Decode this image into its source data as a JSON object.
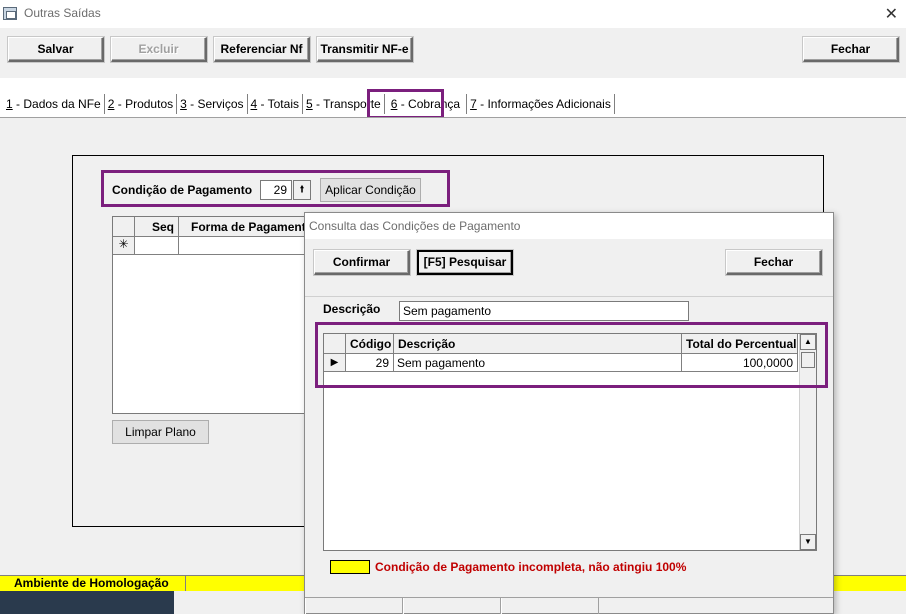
{
  "window": {
    "title": "Outras Saídas",
    "close_glyph": "✕"
  },
  "toolbar": {
    "salvar": "Salvar",
    "excluir": "Excluir",
    "referenciar": "Referenciar Nf",
    "transmitir": "Transmitir NF-e",
    "fechar": "Fechar"
  },
  "tabs": [
    {
      "key": "1",
      "label": " - Dados da NFe"
    },
    {
      "key": "2",
      "label": " - Produtos"
    },
    {
      "key": "3",
      "label": " - Serviços"
    },
    {
      "key": "4",
      "label": " - Totais"
    },
    {
      "key": "5",
      "label": " - Transporte"
    },
    {
      "key": "6",
      "label": " - Cobrança"
    },
    {
      "key": "7",
      "label": " - Informações Adicionais"
    }
  ],
  "cobranca": {
    "condicao_label": "Condição de Pagamento",
    "condicao_value": "29",
    "aplicar_button": "Aplicar Condição",
    "grid_headers": {
      "seq": "Seq",
      "forma": "Forma de Pagamento"
    },
    "new_row_marker": "✳",
    "limpar_button": "Limpar Plano"
  },
  "status": {
    "ambiente": "Ambiente de Homologação"
  },
  "dialog": {
    "title": "Consulta das Condições de Pagamento",
    "confirmar": "Confirmar",
    "pesquisar": "[F5] Pesquisar",
    "fechar": "Fechar",
    "descricao_label": "Descrição",
    "descricao_value": "Sem pagamento",
    "grid_headers": {
      "codigo": "Código",
      "descricao": "Descrição",
      "total": "Total do Percentual"
    },
    "rows": [
      {
        "codigo": "29",
        "descricao": "Sem pagamento",
        "total": "100,0000"
      }
    ],
    "row_indicator": "▶",
    "legend_text": "Condição de Pagamento incompleta, não atingiu 100%"
  },
  "colors": {
    "highlight": "#7b1f7d",
    "status_yellow": "#ffff00",
    "warning_red": "#c00000"
  }
}
